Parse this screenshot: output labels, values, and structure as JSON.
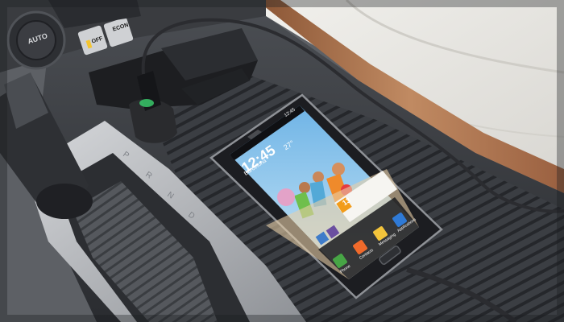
{
  "dashboard": {
    "auto_label": "AUTO",
    "off_label": "OFF",
    "econ_label": "ECON"
  },
  "phone": {
    "clock": "12:45",
    "weather_temp": "27°",
    "weather_city": "Barcelona",
    "status_time": "12:45",
    "calendar_day": "13",
    "dock": {
      "phone": "Phone",
      "contacts": "Contacts",
      "messaging": "Messaging",
      "applications": "Applications"
    }
  },
  "colors": {
    "console_dark": "#2e3034",
    "trim_silver": "#b9bcc1",
    "wood_trim": "#a7704b",
    "leather": "#ecebe7",
    "phone_body": "#1c1d21",
    "screen_sky": "#8fc6ea",
    "charger_light": "#38c76a"
  }
}
